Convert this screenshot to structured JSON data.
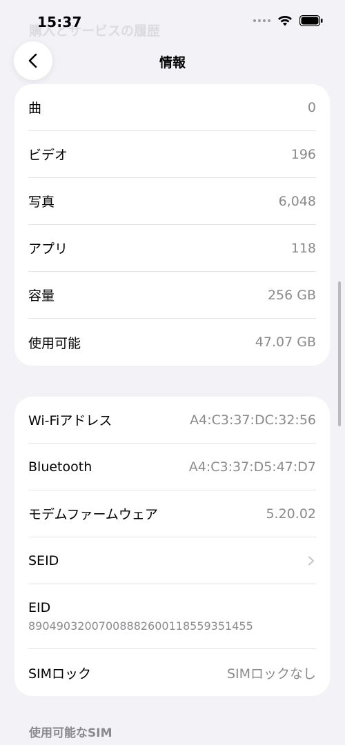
{
  "status_bar": {
    "time": "15:37",
    "faded_title": "購入とサービスの履歴"
  },
  "nav": {
    "title": "情報",
    "back_icon": "chevron-left-icon"
  },
  "group1": {
    "rows": [
      {
        "label": "曲",
        "value": "0"
      },
      {
        "label": "ビデオ",
        "value": "196"
      },
      {
        "label": "写真",
        "value": "6,048"
      },
      {
        "label": "アプリ",
        "value": "118"
      },
      {
        "label": "容量",
        "value": "256 GB"
      },
      {
        "label": "使用可能",
        "value": "47.07 GB"
      }
    ]
  },
  "group2": {
    "wifi": {
      "label": "Wi-Fiアドレス",
      "value": "A4:C3:37:DC:32:56"
    },
    "bluetooth": {
      "label": "Bluetooth",
      "value": "A4:C3:37:D5:47:D7"
    },
    "modem": {
      "label": "モデムファームウェア",
      "value": "5.20.02"
    },
    "seid": {
      "label": "SEID"
    },
    "eid": {
      "label": "EID",
      "value": "89049032007008882600118559351455"
    },
    "sim_lock": {
      "label": "SIMロック",
      "value": "SIMロックなし"
    }
  },
  "section_header": "使用可能なSIM",
  "colors": {
    "background": "#f2f2f7",
    "card": "#ffffff",
    "secondary_text": "#8a8a8e"
  }
}
